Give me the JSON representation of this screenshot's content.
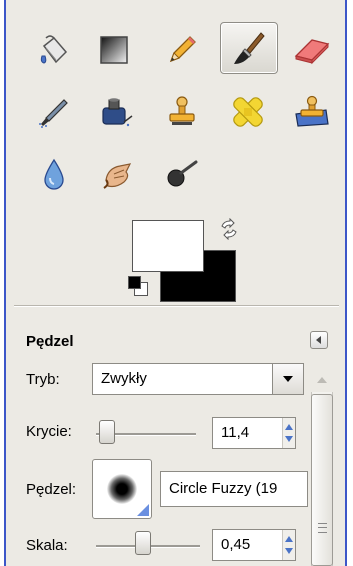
{
  "tool_options": {
    "title": "Pędzel",
    "mode_label": "Tryb:",
    "mode_value": "Zwykły",
    "opacity_label": "Krycie:",
    "opacity_value": "11,4",
    "opacity_level": 0.114,
    "brush_label": "Pędzel:",
    "brush_name": "Circle Fuzzy (19",
    "scale_label": "Skala:",
    "scale_value": "0,45",
    "scale_level": 0.45
  },
  "colors": {
    "foreground": "#ffffff",
    "background": "#000000",
    "frame_accent": "#3c56c8"
  },
  "tools": [
    {
      "icon": "bucket-fill-icon"
    },
    {
      "icon": "blend-gradient-icon"
    },
    {
      "icon": "pencil-icon"
    },
    {
      "icon": "paintbrush-icon",
      "active": true
    },
    {
      "icon": "eraser-icon"
    },
    {
      "icon": "airbrush-icon"
    },
    {
      "icon": "ink-icon"
    },
    {
      "icon": "clone-stamp-icon"
    },
    {
      "icon": "heal-icon"
    },
    {
      "icon": "perspective-clone-icon"
    },
    {
      "icon": "blur-sharpen-icon"
    },
    {
      "icon": "smudge-icon"
    },
    {
      "icon": "dodge-burn-icon"
    }
  ]
}
